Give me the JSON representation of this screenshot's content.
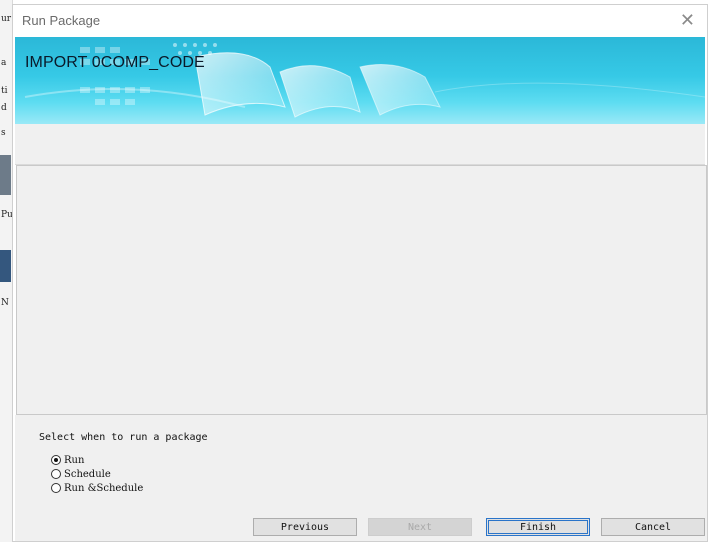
{
  "background_app": {
    "fragments": [
      "ur",
      "a",
      "ti",
      "d",
      "s",
      "Pu",
      "N"
    ]
  },
  "dialog": {
    "title": "Run Package",
    "close_icon": "close-icon",
    "banner_title": "IMPORT 0COMP_CODE",
    "select_label": "Select when to run a package",
    "options": [
      {
        "label": "Run",
        "checked": true
      },
      {
        "label": "Schedule",
        "checked": false
      },
      {
        "label": "Run &Schedule",
        "checked": false
      }
    ],
    "buttons": {
      "previous": "Previous",
      "next": "Next",
      "finish": "Finish",
      "cancel": "Cancel"
    }
  },
  "colors": {
    "banner_top": "#2bb8d8",
    "banner_bottom": "#9ae9f7",
    "panel_bg": "#f0f0f0",
    "focus_border": "#2a74c9"
  }
}
